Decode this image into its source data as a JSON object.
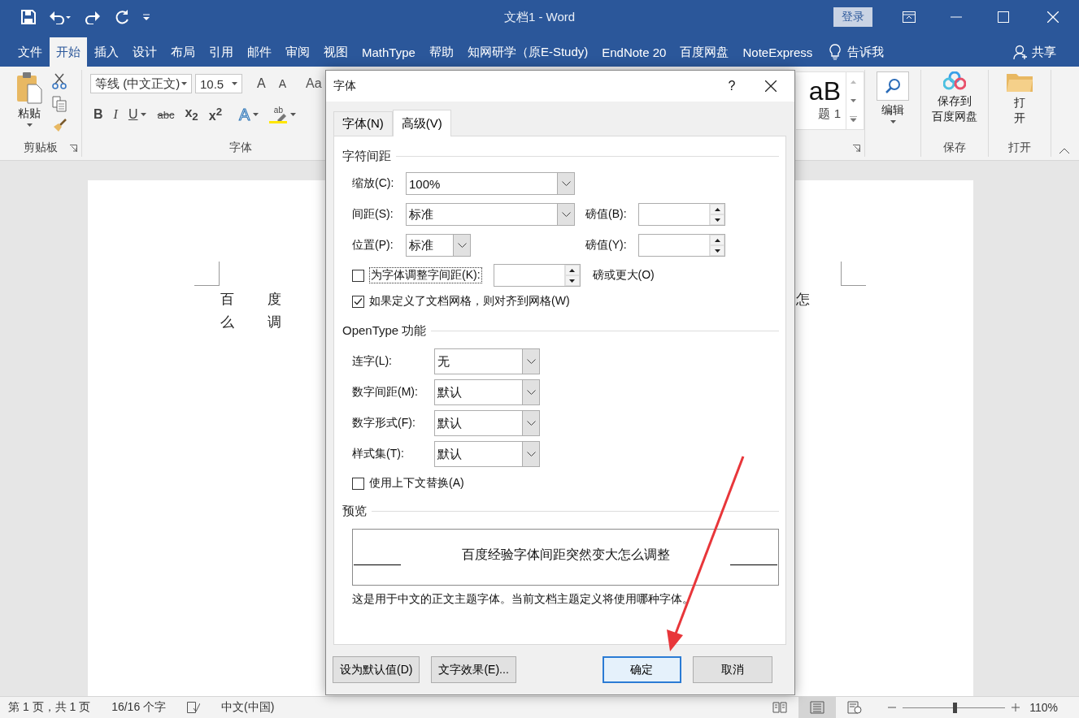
{
  "window": {
    "title": "文档1  -  Word",
    "sign_in": "登录"
  },
  "ribbon_tabs": [
    {
      "label": "文件",
      "selected": false
    },
    {
      "label": "开始",
      "selected": true
    },
    {
      "label": "插入",
      "selected": false
    },
    {
      "label": "设计",
      "selected": false
    },
    {
      "label": "布局",
      "selected": false
    },
    {
      "label": "引用",
      "selected": false
    },
    {
      "label": "邮件",
      "selected": false
    },
    {
      "label": "审阅",
      "selected": false
    },
    {
      "label": "视图",
      "selected": false
    },
    {
      "label": "MathType",
      "selected": false
    },
    {
      "label": "帮助",
      "selected": false
    },
    {
      "label": "知网研学（原E-Study)",
      "selected": false
    },
    {
      "label": "EndNote 20",
      "selected": false
    },
    {
      "label": "百度网盘",
      "selected": false
    },
    {
      "label": "NoteExpress",
      "selected": false
    }
  ],
  "tell_me": "告诉我",
  "share": "共享",
  "ribbon": {
    "clipboard": {
      "paste": "粘贴",
      "group_label": "剪贴板"
    },
    "font": {
      "font_name": "等线 (中文正文)",
      "font_size": "10.5",
      "grow": "A",
      "shrink": "A",
      "change_case": "Aa",
      "format_buttons": [
        {
          "label": "B",
          "kind": "bold"
        },
        {
          "label": "I",
          "kind": "italic"
        },
        {
          "label": "U",
          "kind": "underline"
        },
        {
          "label": "abc",
          "kind": "strike"
        },
        {
          "label": "x$_{2}$",
          "kind": "script"
        },
        {
          "label": "x$^{2}$",
          "kind": "script"
        }
      ],
      "text_effects": "A",
      "highlight": "ab",
      "group_label": "字体"
    },
    "styles": {
      "preview": "aB",
      "style_name": "题 1"
    },
    "editing": {
      "label": "编辑"
    },
    "baidu": {
      "label_lines": [
        "保存到",
        "百度网盘"
      ],
      "group_label": "保存"
    },
    "open": {
      "label_lines": [
        "打",
        "开"
      ],
      "group_label": "打开"
    }
  },
  "document": {
    "lines": [
      {
        "chars": [
          "百",
          "度"
        ],
        "end": "怎"
      },
      {
        "chars": [
          "么",
          "调"
        ]
      }
    ]
  },
  "dialog": {
    "title": "字体",
    "help": "?",
    "tabs": [
      {
        "label": "字体(N)",
        "selected": false
      },
      {
        "label": "高级(V)",
        "selected": true
      }
    ],
    "spacing": {
      "heading": "字符间距",
      "scale": {
        "label": "缩放(C):",
        "value": "100%"
      },
      "spacing": {
        "label": "间距(S):",
        "value": "标准"
      },
      "spacing_by": {
        "label": "磅值(B):"
      },
      "position": {
        "label": "位置(P):",
        "value": "标准"
      },
      "position_by": {
        "label": "磅值(Y):"
      },
      "kerning": {
        "label": "为字体调整字间距(K):",
        "checked": false,
        "suffix": "磅或更大(O)"
      },
      "snap": {
        "label": "如果定义了文档网格，则对齐到网格(W)",
        "checked": true
      }
    },
    "opentype": {
      "heading": "OpenType 功能",
      "rows": [
        {
          "label": "连字(L):",
          "value": "无"
        },
        {
          "label": "数字间距(M):",
          "value": "默认"
        },
        {
          "label": "数字形式(F):",
          "value": "默认"
        },
        {
          "label": "样式集(T):",
          "value": "默认"
        }
      ],
      "contextual": {
        "label": "使用上下文替换(A)",
        "checked": false
      }
    },
    "preview": {
      "heading": "预览",
      "sample": "百度经验字体间距突然变大怎么调整",
      "note": "这是用于中文的正文主题字体。当前文档主题定义将使用哪种字体。"
    },
    "buttons": [
      {
        "label": "设为默认值(D)",
        "default": false
      },
      {
        "label": "文字效果(E)...",
        "default": false
      },
      {
        "label": "确定",
        "default": true
      },
      {
        "label": "取消",
        "default": false
      }
    ]
  },
  "status_bar": {
    "page": "第 1 页，共 1 页",
    "words": "16/16 个字",
    "language": "中文(中国)",
    "views": [
      {
        "kind": "read",
        "selected": false
      },
      {
        "kind": "print",
        "selected": true
      },
      {
        "kind": "web",
        "selected": false
      }
    ],
    "zoom": {
      "level": 0.51
    },
    "zoom_text": "110%"
  }
}
